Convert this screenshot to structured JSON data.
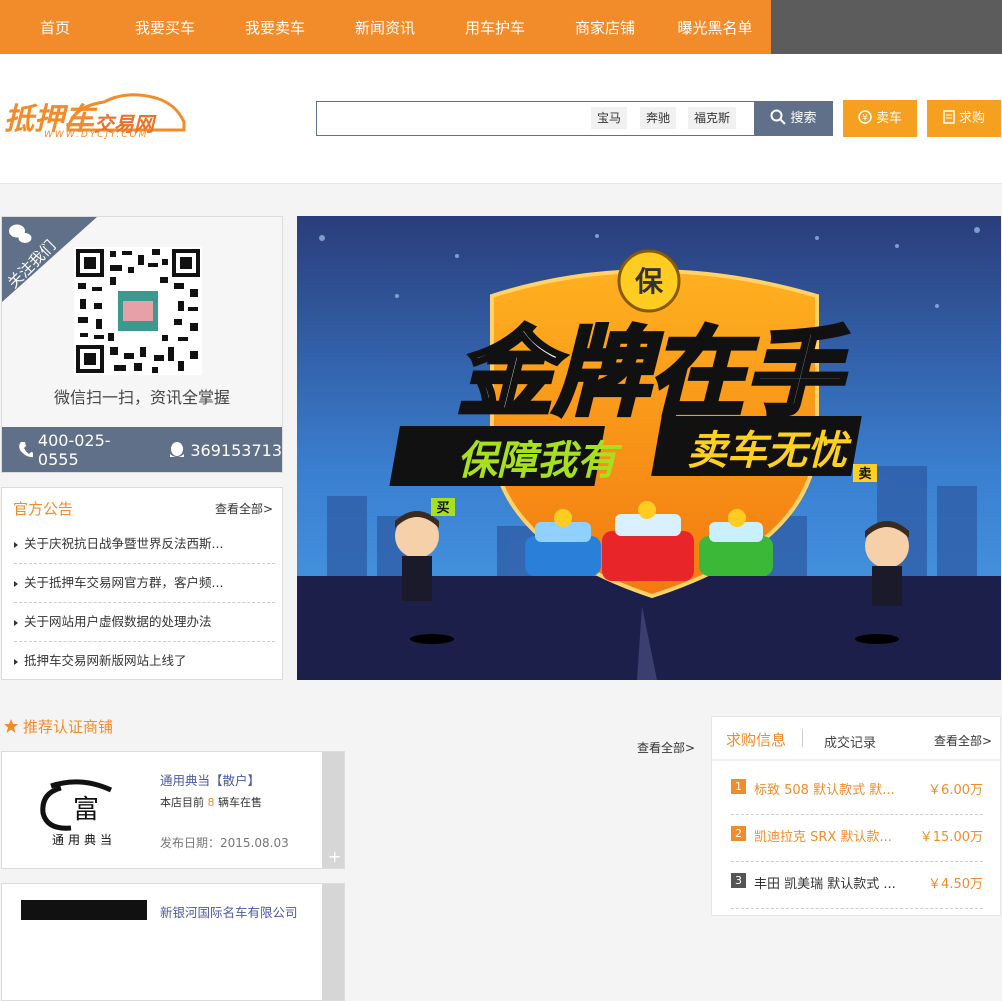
{
  "nav": {
    "items": [
      "首页",
      "我要买车",
      "我要卖车",
      "新闻资讯",
      "用车护车",
      "商家店铺",
      "曝光黑名单"
    ]
  },
  "logo": {
    "main": "抵押车",
    "sub": "交易网",
    "url": "WWW.DYCJY.COM"
  },
  "search": {
    "value": "",
    "hot_tags": [
      "宝马",
      "奔驰",
      "福克斯"
    ],
    "button_label": "搜索"
  },
  "header_buttons": {
    "sell": "卖车",
    "buy": "求购"
  },
  "follow": {
    "ribbon": "关注我们",
    "scan_text": "微信扫一扫，资讯全掌握",
    "phone": "400-025-0555",
    "qq": "369153713"
  },
  "notices": {
    "title": "官方公告",
    "more": "查看全部>",
    "items": [
      "关于庆祝抗日战争暨世界反法西斯...",
      "关于抵押车交易网官方群，客户频...",
      "关于网站用户虚假数据的处理办法",
      "抵押车交易网新版网站上线了"
    ]
  },
  "banner": {
    "badge": "保",
    "headline": "金牌在手",
    "slogan_left": "保障我有",
    "slogan_right": "卖车无忧",
    "sign_buy": "买",
    "sign_sell": "卖",
    "car_badge": "保"
  },
  "shops": {
    "title": "推荐认证商铺",
    "more": "查看全部>",
    "items": [
      {
        "logo_char": "富",
        "logo_text": "通用典当",
        "name": "通用典当【散户】",
        "info_prefix": "本店目前",
        "count": "8",
        "info_suffix": "辆车在售",
        "date": "发布日期：2015.08.03"
      },
      {
        "name": "新银河国际名车有限公司"
      }
    ]
  },
  "requests": {
    "tab_active": "求购信息",
    "tab_other": "成交记录",
    "more": "查看全部>",
    "items": [
      {
        "num": "1",
        "title": "标致 508 默认款式 默...",
        "price": "￥6.00万"
      },
      {
        "num": "2",
        "title": "凯迪拉克 SRX 默认款...",
        "price": "￥15.00万"
      },
      {
        "num": "3",
        "title": "丰田 凯美瑞 默认款式 ...",
        "price": "￥4.50万"
      }
    ]
  },
  "colors": {
    "accent": "#f28c2a",
    "slate": "#5f7088",
    "orange_btn": "#f5a01e"
  }
}
